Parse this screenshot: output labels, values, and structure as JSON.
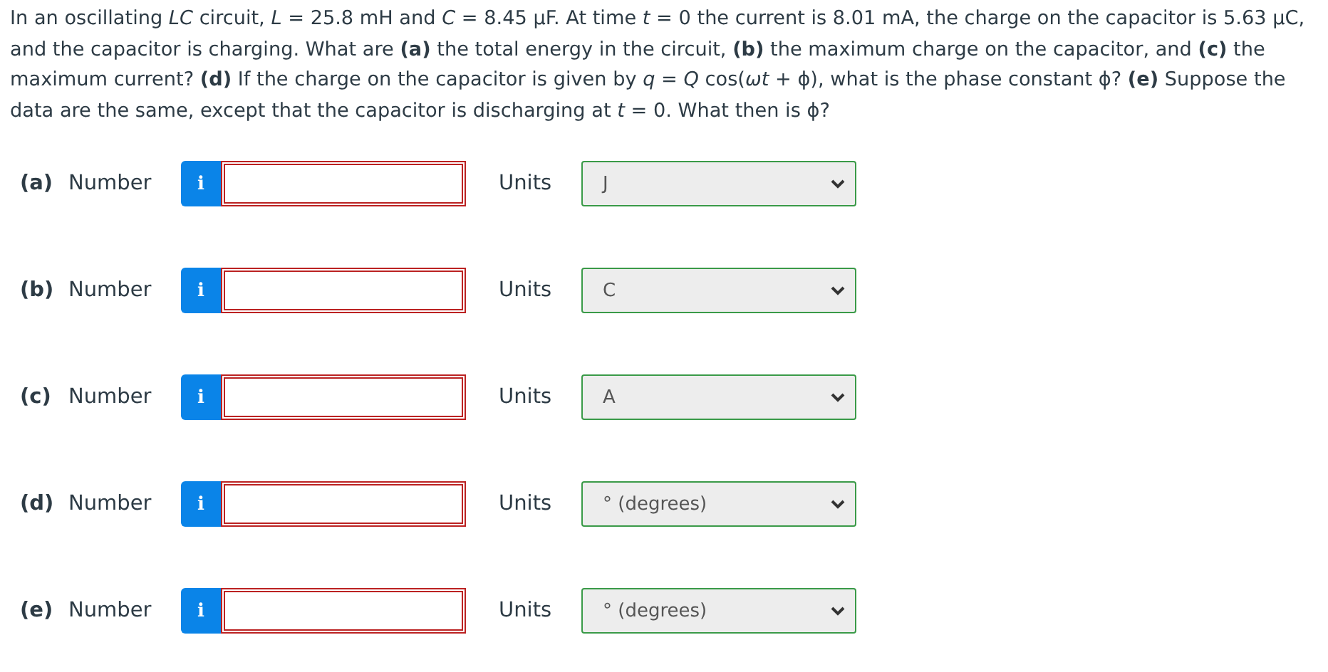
{
  "question": "In an oscillating *LC* circuit, *L* = 25.8 mH and *C* = 8.45 µF. At time *t* = 0 the current is 8.01 mA, the charge on the capacitor is 5.63 µC, and the capacitor is charging. What are **(a)** the total energy in the circuit, **(b)** the maximum charge on the capacitor, and **(c)** the maximum current? **(d)** If the charge on the capacitor is given by *q* = *Q* cos(*ωt* + ϕ), what is the phase constant ϕ? **(e)** Suppose the data are the same, except that the capacitor is discharging at *t* = 0. What then is ϕ?",
  "parts": [
    {
      "label": "(a)",
      "field_label": "Number",
      "info": "i",
      "answer_correct": false,
      "units_label": "Units",
      "units": "J",
      "units_correct": true
    },
    {
      "label": "(b)",
      "field_label": "Number",
      "info": "i",
      "answer_correct": false,
      "units_label": "Units",
      "units": "C",
      "units_correct": true
    },
    {
      "label": "(c)",
      "field_label": "Number",
      "info": "i",
      "answer_correct": false,
      "units_label": "Units",
      "units": "A",
      "units_correct": true
    },
    {
      "label": "(d)",
      "field_label": "Number",
      "info": "i",
      "answer_correct": false,
      "units_label": "Units",
      "units": "° (degrees)",
      "units_correct": true
    },
    {
      "label": "(e)",
      "field_label": "Number",
      "info": "i",
      "answer_correct": false,
      "units_label": "Units",
      "units": "° (degrees)",
      "units_correct": true
    }
  ]
}
